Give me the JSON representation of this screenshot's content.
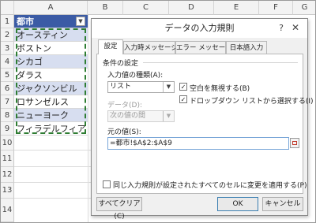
{
  "sheet": {
    "columns": [
      "A",
      "B",
      "C",
      "D",
      "E",
      "F",
      "G"
    ],
    "rows": [
      "1",
      "2",
      "3",
      "4",
      "5",
      "6",
      "7",
      "8",
      "9",
      "10",
      "11",
      "12",
      "13",
      "14"
    ],
    "header_cell": "都市",
    "filter_icon": "filter-dropdown-icon",
    "cells": [
      "オースティン",
      "ボストン",
      "シカゴ",
      "ダラス",
      "ジャクソンビル",
      "ロサンゼルス",
      "ニューヨーク",
      "フィラデルフィア"
    ],
    "header_color": "#3b5ba5",
    "band_color": "#d7def0"
  },
  "dialog": {
    "title": "データの入力規則",
    "help": "?",
    "close": "✕",
    "tabs": [
      "設定",
      "入力時メッセージ",
      "エラー メッセージ",
      "日本語入力"
    ],
    "section_label": "条件の設定",
    "allow_label": "入力値の種類(A):",
    "allow_value": "リスト",
    "data_label": "データ(D):",
    "data_value": "次の値の間",
    "ignore_blank_label": "空白を無視する(B)",
    "ignore_blank_checked": true,
    "dropdown_label": "ドロップダウン リストから選択する(I)",
    "dropdown_checked": true,
    "source_label": "元の値(S):",
    "source_value": "=都市!$A$2:$A$9",
    "apply_all_label": "同じ入力規則が設定されたすべてのセルに変更を適用する(P)",
    "apply_all_checked": false,
    "clear_all_button": "すべてクリア(C)",
    "ok_button": "OK",
    "cancel_button": "キャンセル"
  }
}
